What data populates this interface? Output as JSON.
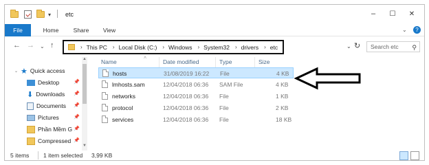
{
  "window": {
    "title": "etc",
    "controls": {
      "minimize": "–",
      "maximize": "☐",
      "close": "✕"
    }
  },
  "ribbon": {
    "tabs": [
      "File",
      "Home",
      "Share",
      "View"
    ]
  },
  "nav": {
    "breadcrumb": [
      "This PC",
      "Local Disk (C:)",
      "Windows",
      "System32",
      "drivers",
      "etc"
    ],
    "search_placeholder": "Search etc"
  },
  "sidebar": {
    "items": [
      {
        "label": "Quick access",
        "icon": "star-icon"
      },
      {
        "label": "Desktop",
        "icon": "desktop-icon",
        "pinned": true
      },
      {
        "label": "Downloads",
        "icon": "download-icon",
        "pinned": true
      },
      {
        "label": "Documents",
        "icon": "documents-icon",
        "pinned": true
      },
      {
        "label": "Pictures",
        "icon": "pictures-icon",
        "pinned": true
      },
      {
        "label": "Phần Mềm G",
        "icon": "folder-icon",
        "pinned": true
      },
      {
        "label": "Compressed",
        "icon": "folder-icon",
        "pinned": true
      }
    ]
  },
  "table": {
    "columns": [
      "Name",
      "Date modified",
      "Type",
      "Size"
    ],
    "rows": [
      {
        "name": "hosts",
        "date": "31/08/2019 16:22",
        "type": "File",
        "size": "4 KB",
        "selected": true
      },
      {
        "name": "lmhosts.sam",
        "date": "12/04/2018 06:36",
        "type": "SAM File",
        "size": "4 KB"
      },
      {
        "name": "networks",
        "date": "12/04/2018 06:36",
        "type": "File",
        "size": "1 KB"
      },
      {
        "name": "protocol",
        "date": "12/04/2018 06:36",
        "type": "File",
        "size": "2 KB"
      },
      {
        "name": "services",
        "date": "12/04/2018 06:36",
        "type": "File",
        "size": "18 KB"
      }
    ]
  },
  "status": {
    "items_count": "5 items",
    "selection": "1 item selected",
    "selection_size": "3,99 KB"
  },
  "colors": {
    "accent": "#1979ca",
    "selection": "#cce8ff",
    "annotation": "#000000"
  }
}
